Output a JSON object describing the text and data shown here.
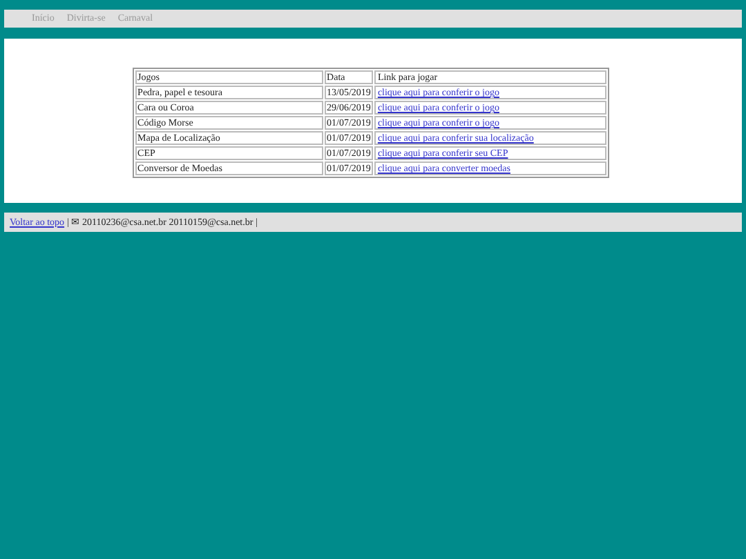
{
  "nav": [
    {
      "label": "Início"
    },
    {
      "label": "Divirta-se"
    },
    {
      "label": "Carnaval"
    }
  ],
  "table": {
    "columns": [
      "Jogos",
      "Data",
      "Link para jogar"
    ],
    "rows": [
      [
        "Pedra, papel e tesoura",
        "13/05/2019",
        "clique aqui para conferir o jogo"
      ],
      [
        "Cara ou Coroa",
        "29/06/2019",
        "clique aqui para conferir o jogo"
      ],
      [
        "Código Morse",
        "01/07/2019",
        "clique aqui para conferir o jogo"
      ],
      [
        "Mapa de Localização",
        "01/07/2019",
        "clique aqui para conferir sua localização"
      ],
      [
        "CEP",
        "01/07/2019",
        "clique aqui para conferir seu CEP"
      ],
      [
        "Conversor de Moedas",
        "01/07/2019",
        "clique aqui para converter moedas"
      ]
    ]
  },
  "footer": {
    "link": "Voltar ao topo",
    "text": "| ✉ 20110236@csa.net.br 20110159@csa.net.br |"
  }
}
